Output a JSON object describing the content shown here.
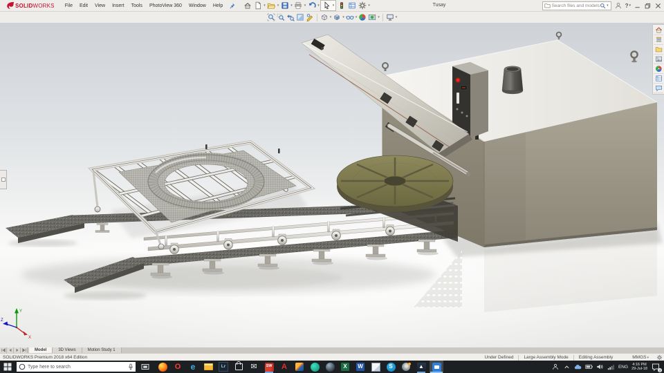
{
  "colors": {
    "solidworks_red": "#c8102e",
    "titlebar_bg": "#efedea",
    "taskbar_bg": "#1d2023",
    "selection_blue": "#6aa7d8",
    "machine_body": "#a19b8d",
    "machine_top": "#f2f1ed",
    "disc_olive": "#7d7950",
    "viewport_top": "#cfd3d8",
    "floor_white": "#fbfbfa"
  },
  "titlebar": {
    "logo_bold": "SOLID",
    "logo_light": "WORKS",
    "menus": [
      "File",
      "Edit",
      "View",
      "Insert",
      "Tools",
      "PhotoView 360",
      "Window",
      "Help"
    ],
    "document_title": "Tusay",
    "search_placeholder": "Search files and models",
    "help_label": "?"
  },
  "toolbars": {
    "main": [
      "home",
      "new-document",
      "open",
      "save",
      "print",
      "undo",
      "select",
      "rebuild",
      "display-settings",
      "options"
    ],
    "view": [
      "zoom-to-fit",
      "zoom-to-area",
      "previous-view",
      "section-view",
      "annotation-views",
      "view-orientation",
      "display-style",
      "hide-show-items",
      "edit-appearance",
      "apply-scene",
      "view-settings"
    ]
  },
  "taskpane_tabs": [
    "solidworks-resources",
    "design-library",
    "file-explorer",
    "view-palette",
    "appearances-scenes",
    "custom-properties",
    "solidworks-forum"
  ],
  "viewport": {
    "triad": {
      "x": "X",
      "y": "Y",
      "z": "Z"
    }
  },
  "doc_tabs": {
    "tabs": [
      {
        "label": "Model",
        "active": true
      },
      {
        "label": "3D Views",
        "active": false
      },
      {
        "label": "Motion Study 1",
        "active": false
      }
    ]
  },
  "statusbar": {
    "edition": "SOLIDWORKS Premium 2018 x64 Edition",
    "constraint_state": "Under Defined",
    "assembly_mode": "Large Assembly Mode",
    "editing_state": "Editing Assembly",
    "units": "MMGS"
  },
  "taskbar": {
    "search_placeholder": "Type here to search",
    "apps": [
      {
        "id": "firefox",
        "glyph": ""
      },
      {
        "id": "opera",
        "glyph": "O"
      },
      {
        "id": "edge",
        "glyph": "e"
      },
      {
        "id": "file-explorer",
        "glyph": ""
      },
      {
        "id": "lightroom",
        "glyph": "Lr"
      },
      {
        "id": "store",
        "glyph": ""
      },
      {
        "id": "mail",
        "glyph": "✉"
      },
      {
        "id": "solidworks",
        "glyph": "SW",
        "active": true
      },
      {
        "id": "autocad",
        "glyph": "A"
      },
      {
        "id": "cube-app",
        "glyph": ""
      },
      {
        "id": "teal-app",
        "glyph": ""
      },
      {
        "id": "sphere-app",
        "glyph": ""
      },
      {
        "id": "excel",
        "glyph": "X"
      },
      {
        "id": "word",
        "glyph": "W"
      },
      {
        "id": "notes",
        "glyph": ""
      },
      {
        "id": "skype",
        "glyph": "S"
      },
      {
        "id": "planet-app",
        "glyph": ""
      },
      {
        "id": "photos",
        "glyph": "▲",
        "active": true
      },
      {
        "id": "video-app",
        "glyph": "",
        "active": true,
        "focused": true
      }
    ],
    "tray": {
      "language": "ENG",
      "time": "4:16 PM",
      "date": "29-Jul-18",
      "notification_count": "3"
    }
  }
}
